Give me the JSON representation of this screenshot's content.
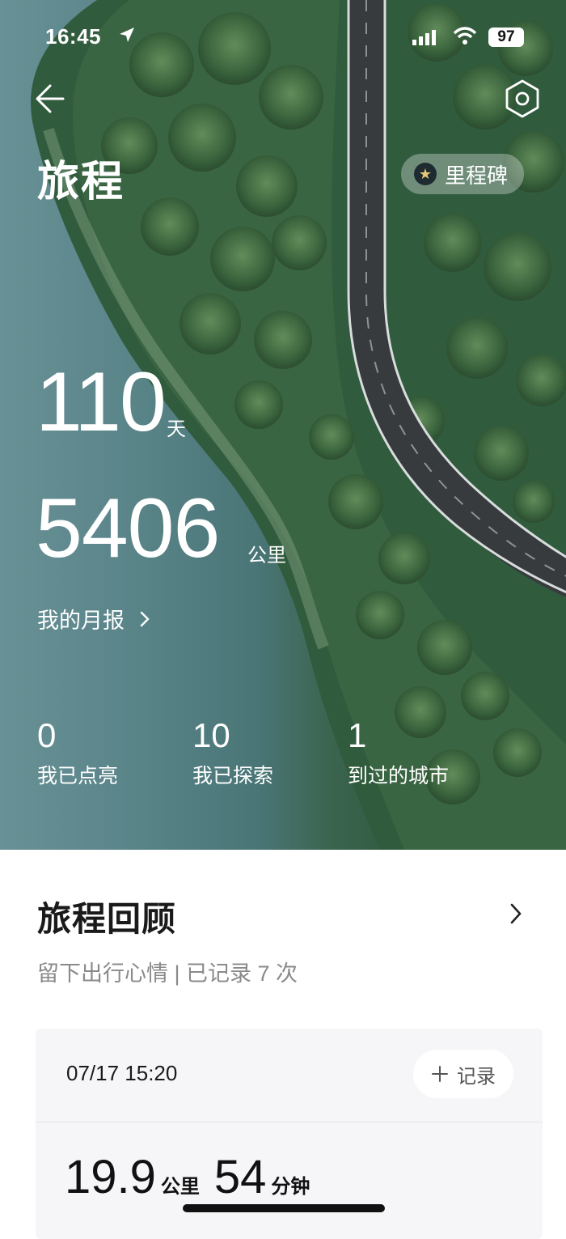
{
  "status_bar": {
    "time": "16:45",
    "battery": "97"
  },
  "header": {
    "title": "旅程",
    "milestone_label": "里程碑"
  },
  "summary": {
    "days_value": "110",
    "days_unit": "天",
    "distance_value": "5406",
    "distance_unit": "公里",
    "monthly_report_label": "我的月报"
  },
  "stats": [
    {
      "value": "0",
      "label": "我已点亮"
    },
    {
      "value": "10",
      "label": "我已探索"
    },
    {
      "value": "1",
      "label": "到过的城市"
    }
  ],
  "review": {
    "title": "旅程回顾",
    "subtitle": "留下出行心情 | 已记录 7 次",
    "card": {
      "datetime": "07/17 15:20",
      "record_button": "记录",
      "distance_value": "19.9",
      "distance_unit": "公里",
      "duration_value": "54",
      "duration_unit": "分钟"
    }
  },
  "icons": [
    "location-arrow-icon",
    "cellular-signal-icon",
    "wifi-icon",
    "battery-icon",
    "back-arrow-icon",
    "settings-hexagon-icon",
    "star-icon",
    "chevron-right-icon",
    "plus-icon"
  ],
  "colors": {
    "water": "#5e8c90",
    "forest": "#2f5a3c",
    "road": "#3a3d40",
    "text_dark": "#1a1a1a",
    "text_muted": "#8a8a8a",
    "card_bg": "#f6f6f8"
  }
}
